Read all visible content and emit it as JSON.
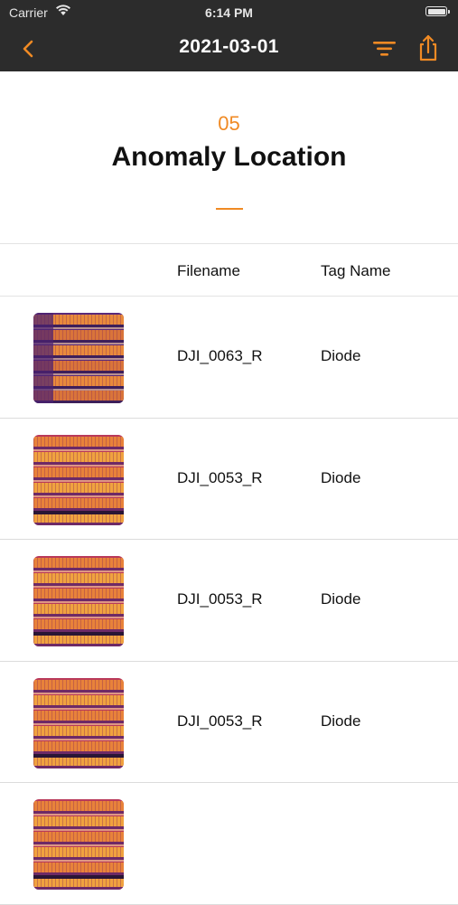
{
  "status_bar": {
    "carrier": "Carrier",
    "time": "6:14 PM"
  },
  "nav": {
    "title": "2021-03-01",
    "icons": {
      "back": "chevron-left-icon",
      "filter": "filter-icon",
      "share": "share-icon"
    },
    "accent_color": "#f08a24",
    "bar_color": "#2c2c2c"
  },
  "section": {
    "number": "05",
    "title": "Anomaly Location"
  },
  "table": {
    "headers": {
      "filename": "Filename",
      "tag_name": "Tag Name"
    },
    "rows": [
      {
        "filename": "DJI_0063_R",
        "tag_name": "Diode"
      },
      {
        "filename": "DJI_0053_R",
        "tag_name": "Diode"
      },
      {
        "filename": "DJI_0053_R",
        "tag_name": "Diode"
      },
      {
        "filename": "DJI_0053_R",
        "tag_name": "Diode"
      },
      {
        "filename": "",
        "tag_name": ""
      }
    ]
  }
}
